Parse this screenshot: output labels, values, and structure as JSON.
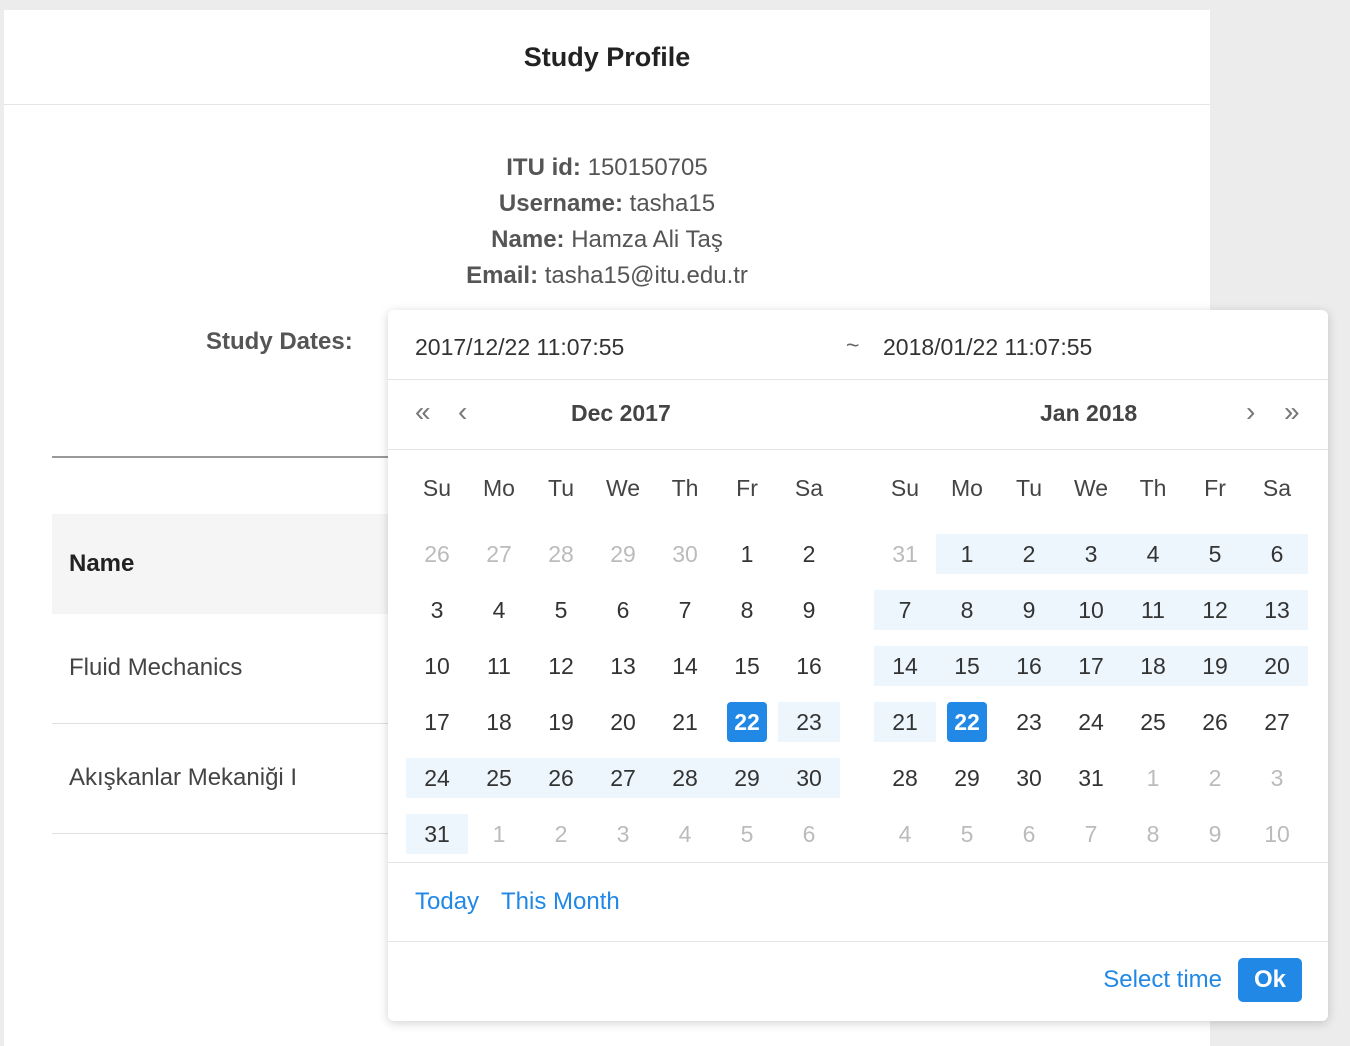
{
  "modal": {
    "title": "Study Profile"
  },
  "profile": {
    "itu_id_label": "ITU id:",
    "itu_id": "150150705",
    "username_label": "Username:",
    "username": "tasha15",
    "name_label": "Name:",
    "name": "Hamza Ali Taş",
    "email_label": "Email:",
    "email": "tasha15@itu.edu.tr"
  },
  "study_dates_label": "Study Dates:",
  "table": {
    "header_name": "Name",
    "rows": [
      "Fluid Mechanics",
      "Akışkanlar Mekaniği I"
    ]
  },
  "picker": {
    "start_value": "2017/12/22 11:07:55",
    "separator": "~",
    "end_value": "2018/01/22 11:07:55",
    "nav": {
      "prev_year": "«",
      "prev_month": "‹",
      "next_month": "›",
      "next_year": "»"
    },
    "left_title": "Dec 2017",
    "right_title": "Jan 2018",
    "weekdays": [
      "Su",
      "Mo",
      "Tu",
      "We",
      "Th",
      "Fr",
      "Sa"
    ],
    "shortcuts": {
      "today": "Today",
      "this_month": "This Month"
    },
    "select_time": "Select time",
    "ok": "Ok",
    "accent_color": "#2188e6",
    "range_color": "#edf6fd",
    "left_days": [
      [
        [
          "26",
          "muted"
        ],
        [
          "27",
          "muted"
        ],
        [
          "28",
          "muted"
        ],
        [
          "29",
          "muted"
        ],
        [
          "30",
          "muted"
        ],
        [
          "1",
          ""
        ],
        [
          "2",
          ""
        ]
      ],
      [
        [
          "3",
          ""
        ],
        [
          "4",
          ""
        ],
        [
          "5",
          ""
        ],
        [
          "6",
          ""
        ],
        [
          "7",
          ""
        ],
        [
          "8",
          ""
        ],
        [
          "9",
          ""
        ]
      ],
      [
        [
          "10",
          ""
        ],
        [
          "11",
          ""
        ],
        [
          "12",
          ""
        ],
        [
          "13",
          ""
        ],
        [
          "14",
          ""
        ],
        [
          "15",
          ""
        ],
        [
          "16",
          ""
        ]
      ],
      [
        [
          "17",
          ""
        ],
        [
          "18",
          ""
        ],
        [
          "19",
          ""
        ],
        [
          "20",
          ""
        ],
        [
          "21",
          ""
        ],
        [
          "22",
          "sel"
        ],
        [
          "23",
          "range"
        ]
      ],
      [
        [
          "24",
          "range"
        ],
        [
          "25",
          "range"
        ],
        [
          "26",
          "range"
        ],
        [
          "27",
          "range"
        ],
        [
          "28",
          "range"
        ],
        [
          "29",
          "range"
        ],
        [
          "30",
          "range"
        ]
      ],
      [
        [
          "31",
          "range"
        ],
        [
          "1",
          "muted"
        ],
        [
          "2",
          "muted"
        ],
        [
          "3",
          "muted"
        ],
        [
          "4",
          "muted"
        ],
        [
          "5",
          "muted"
        ],
        [
          "6",
          "muted"
        ]
      ]
    ],
    "right_days": [
      [
        [
          "31",
          "muted"
        ],
        [
          "1",
          "range"
        ],
        [
          "2",
          "range"
        ],
        [
          "3",
          "range"
        ],
        [
          "4",
          "range"
        ],
        [
          "5",
          "range"
        ],
        [
          "6",
          "range"
        ]
      ],
      [
        [
          "7",
          "range"
        ],
        [
          "8",
          "range"
        ],
        [
          "9",
          "range"
        ],
        [
          "10",
          "range"
        ],
        [
          "11",
          "range"
        ],
        [
          "12",
          "range"
        ],
        [
          "13",
          "range"
        ]
      ],
      [
        [
          "14",
          "range"
        ],
        [
          "15",
          "range"
        ],
        [
          "16",
          "range"
        ],
        [
          "17",
          "range"
        ],
        [
          "18",
          "range"
        ],
        [
          "19",
          "range"
        ],
        [
          "20",
          "range"
        ]
      ],
      [
        [
          "21",
          "range"
        ],
        [
          "22",
          "sel"
        ],
        [
          "23",
          ""
        ],
        [
          "24",
          ""
        ],
        [
          "25",
          ""
        ],
        [
          "26",
          ""
        ],
        [
          "27",
          ""
        ]
      ],
      [
        [
          "28",
          ""
        ],
        [
          "29",
          ""
        ],
        [
          "30",
          ""
        ],
        [
          "31",
          ""
        ],
        [
          "1",
          "muted"
        ],
        [
          "2",
          "muted"
        ],
        [
          "3",
          "muted"
        ]
      ],
      [
        [
          "4",
          "muted"
        ],
        [
          "5",
          "muted"
        ],
        [
          "6",
          "muted"
        ],
        [
          "7",
          "muted"
        ],
        [
          "8",
          "muted"
        ],
        [
          "9",
          "muted"
        ],
        [
          "10",
          "muted"
        ]
      ]
    ]
  }
}
